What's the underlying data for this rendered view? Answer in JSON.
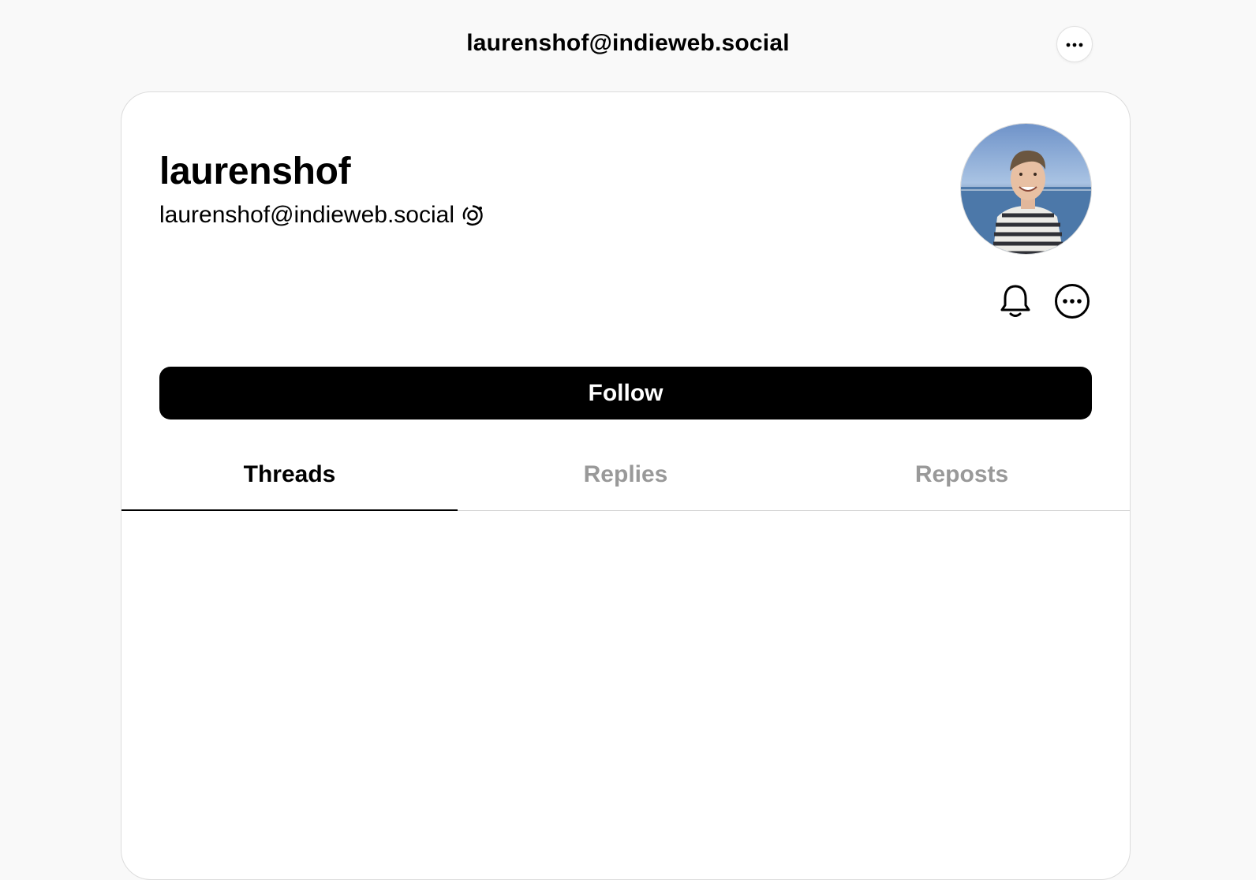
{
  "header": {
    "title": "laurenshof@indieweb.social",
    "menu_icon": "more-horizontal-icon"
  },
  "profile": {
    "display_name": "laurenshof",
    "handle": "laurenshof@indieweb.social",
    "handle_badge_icon": "fediverse-icon",
    "avatar": "profile-photo",
    "actions": {
      "notify_icon": "bell-icon",
      "more_icon": "more-circle-icon"
    },
    "follow_label": "Follow"
  },
  "tabs": [
    {
      "label": "Threads",
      "active": true
    },
    {
      "label": "Replies",
      "active": false
    },
    {
      "label": "Reposts",
      "active": false
    }
  ],
  "colors": {
    "page_background": "#f9f9f9",
    "card_background": "#ffffff",
    "button_background": "#000000",
    "inactive_tab": "#999999"
  }
}
